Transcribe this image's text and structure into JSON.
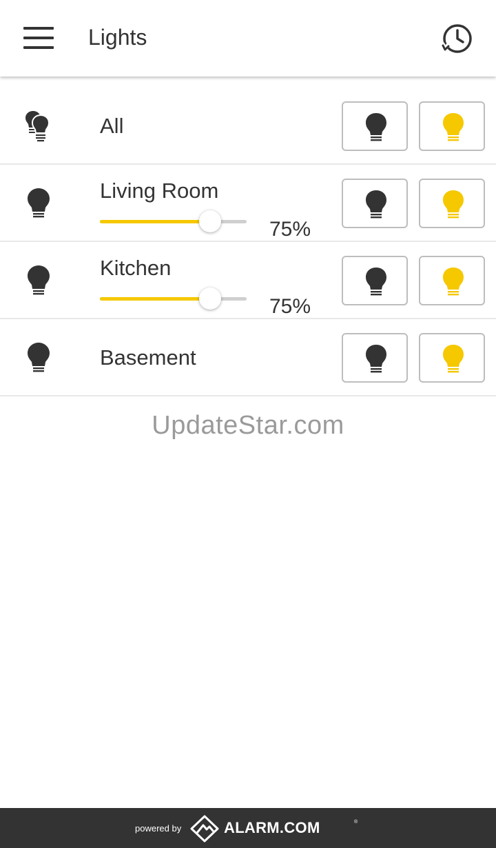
{
  "header": {
    "title": "Lights",
    "menu_icon": "hamburger-menu-icon",
    "history_icon": "history-clock-icon"
  },
  "colors": {
    "accent": "#f5c800",
    "bulb_off": "#333333",
    "footer_bg": "#333333"
  },
  "lights": [
    {
      "name": "All",
      "icon": "multi-bulb-icon",
      "has_slider": false
    },
    {
      "name": "Living Room",
      "icon": "bulb-icon",
      "has_slider": true,
      "level_percent": 75,
      "level_label": "75%"
    },
    {
      "name": "Kitchen",
      "icon": "bulb-icon",
      "has_slider": true,
      "level_percent": 75,
      "level_label": "75%"
    },
    {
      "name": "Basement",
      "icon": "bulb-icon",
      "has_slider": false
    }
  ],
  "watermark": "UpdateStar.com",
  "footer": {
    "powered_by": "powered by",
    "brand": "ALARM.COM",
    "registered": "®"
  }
}
